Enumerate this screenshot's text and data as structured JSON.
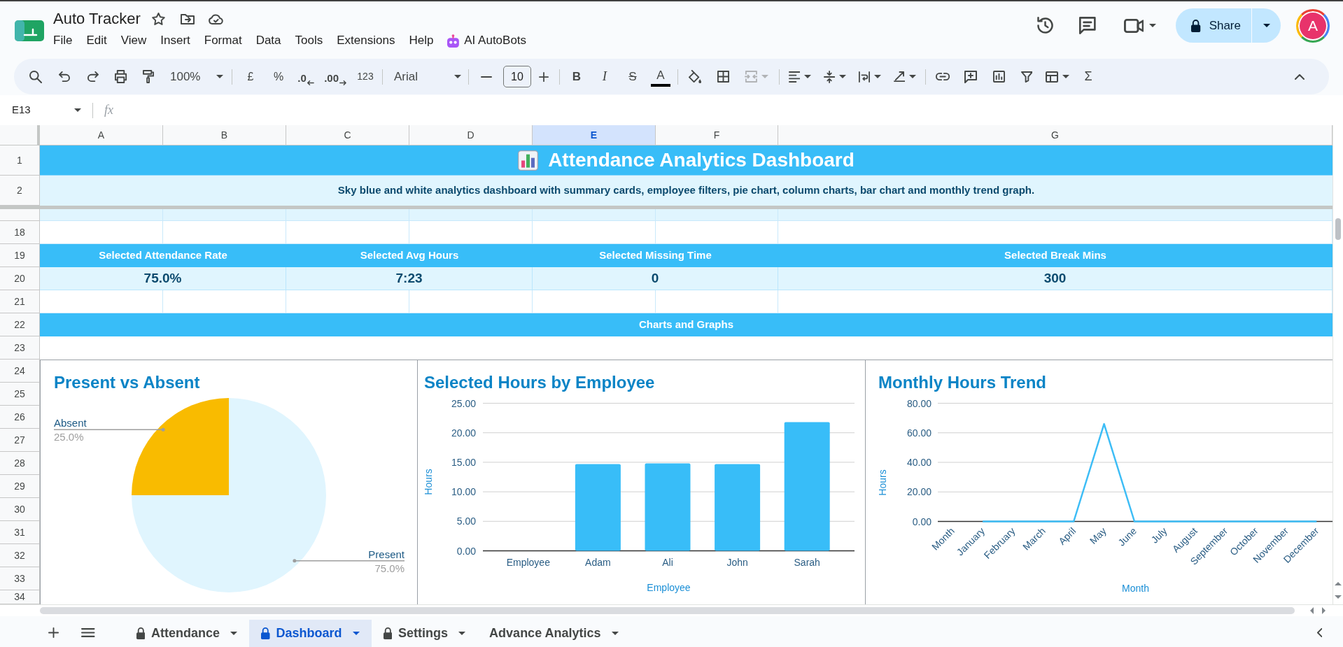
{
  "app": {
    "title": "Auto Tracker",
    "menu": [
      {
        "label": "File",
        "kind": "menu"
      },
      {
        "label": "Edit",
        "kind": "menu"
      },
      {
        "label": "View",
        "kind": "menu"
      },
      {
        "label": "Insert",
        "kind": "menu"
      },
      {
        "label": "Format",
        "kind": "menu"
      },
      {
        "label": "Data",
        "kind": "menu"
      },
      {
        "label": "Tools",
        "kind": "menu"
      },
      {
        "label": "Extensions",
        "kind": "menu"
      },
      {
        "label": "Help",
        "kind": "menu"
      },
      {
        "label": "AI AutoBots",
        "kind": "addon"
      }
    ],
    "share_button": "Share",
    "avatar": "A"
  },
  "toolbar": {
    "zoom": "100%",
    "currency": "£",
    "percent": "%",
    "decrease_decimals": ".0",
    "increase_decimals": ".00",
    "number_format": "123",
    "font": "Arial",
    "font_size": "10",
    "bold": "B",
    "italic": "I",
    "strikethrough": "S",
    "text_color": "A",
    "merge_cells": {
      "disabled": true
    },
    "functions": "Σ"
  },
  "formula_bar": {
    "cell_reference": "E13",
    "function_label": "fx"
  },
  "grid": {
    "columns": [
      {
        "label": "A",
        "selected": false
      },
      {
        "label": "B",
        "selected": false
      },
      {
        "label": "C",
        "selected": false
      },
      {
        "label": "D",
        "selected": false
      },
      {
        "label": "E",
        "selected": true
      },
      {
        "label": "F",
        "selected": false
      },
      {
        "label": "G",
        "selected": false
      }
    ],
    "frozen_rows": [
      {
        "number": "1",
        "kind": "title",
        "text": "Attendance Analytics Dashboard"
      },
      {
        "number": "2",
        "kind": "subtitle",
        "text": "Sky blue and white analytics dashboard with summary cards, employee filters, pie chart, column charts, bar chart and monthly trend graph."
      }
    ],
    "rows": [
      {
        "number": "18",
        "kind": "blank"
      },
      {
        "number": "19",
        "kind": "card_labels",
        "cells": [
          "Selected Attendance Rate",
          "Selected Avg Hours",
          "Selected Missing Time",
          "Selected Break Mins"
        ]
      },
      {
        "number": "20",
        "kind": "card_values",
        "cells": [
          "75.0%",
          "7:23",
          "0",
          "300"
        ]
      },
      {
        "number": "21",
        "kind": "blank"
      },
      {
        "number": "22",
        "kind": "section",
        "text": "Charts and Graphs"
      },
      {
        "number": "23",
        "kind": "spacer"
      }
    ],
    "chart_rows": [
      "24",
      "25",
      "26",
      "27",
      "28",
      "29",
      "30",
      "31",
      "32",
      "33",
      "34"
    ]
  },
  "charts": [
    {
      "chart_data": {
        "type": "pie",
        "title": "Present vs Absent",
        "categories": [
          "Present",
          "Absent"
        ],
        "values": [
          75,
          25
        ],
        "colors": [
          "#e0f5fe",
          "#f9bb00"
        ],
        "value_labels": [
          "75.0%",
          "25.0%"
        ]
      }
    },
    {
      "chart_data": {
        "type": "bar",
        "title": "Selected Hours by Employee",
        "xlabel": "Employee",
        "ylabel": "Hours",
        "orientation": "vertical",
        "grid": true,
        "categories": [
          "Employee",
          "Adam",
          "Ali",
          "John",
          "Sarah"
        ],
        "series": [
          {
            "color": "#38bdf8",
            "values": [
              null,
              14.7,
              14.8,
              14.7,
              21.8
            ]
          }
        ],
        "ylim": [
          0,
          25
        ],
        "yticks": [
          {
            "value": 0,
            "label": "0.00"
          },
          {
            "value": 5,
            "label": "5.00"
          },
          {
            "value": 10,
            "label": "10.00"
          },
          {
            "value": 15,
            "label": "15.00"
          },
          {
            "value": 20,
            "label": "20.00"
          },
          {
            "value": 25,
            "label": "25.00"
          }
        ]
      }
    },
    {
      "chart_data": {
        "type": "line",
        "title": "Monthly Hours Trend",
        "xlabel": "Month",
        "ylabel": "Hours",
        "grid": true,
        "categories": [
          "Month",
          "January",
          "February",
          "March",
          "April",
          "May",
          "June",
          "July",
          "August",
          "September",
          "October",
          "November",
          "December"
        ],
        "series": [
          {
            "color": "#3dbdf6",
            "values": [
              null,
              0,
              0,
              0,
              0,
              66,
              0,
              0,
              0,
              0,
              0,
              0,
              0
            ]
          }
        ],
        "ylim": [
          0,
          80
        ],
        "yticks": [
          {
            "value": 0,
            "label": "0.00"
          },
          {
            "value": 20,
            "label": "20.00"
          },
          {
            "value": 40,
            "label": "40.00"
          },
          {
            "value": 60,
            "label": "60.00"
          },
          {
            "value": 80,
            "label": "80.00"
          }
        ]
      }
    }
  ],
  "tabs": [
    {
      "label": "Attendance",
      "locked": true,
      "selected": false
    },
    {
      "label": "Dashboard",
      "locked": true,
      "selected": true
    },
    {
      "label": "Settings",
      "locked": true,
      "selected": false
    },
    {
      "label": "Advance Analytics",
      "locked": false,
      "selected": false
    }
  ]
}
